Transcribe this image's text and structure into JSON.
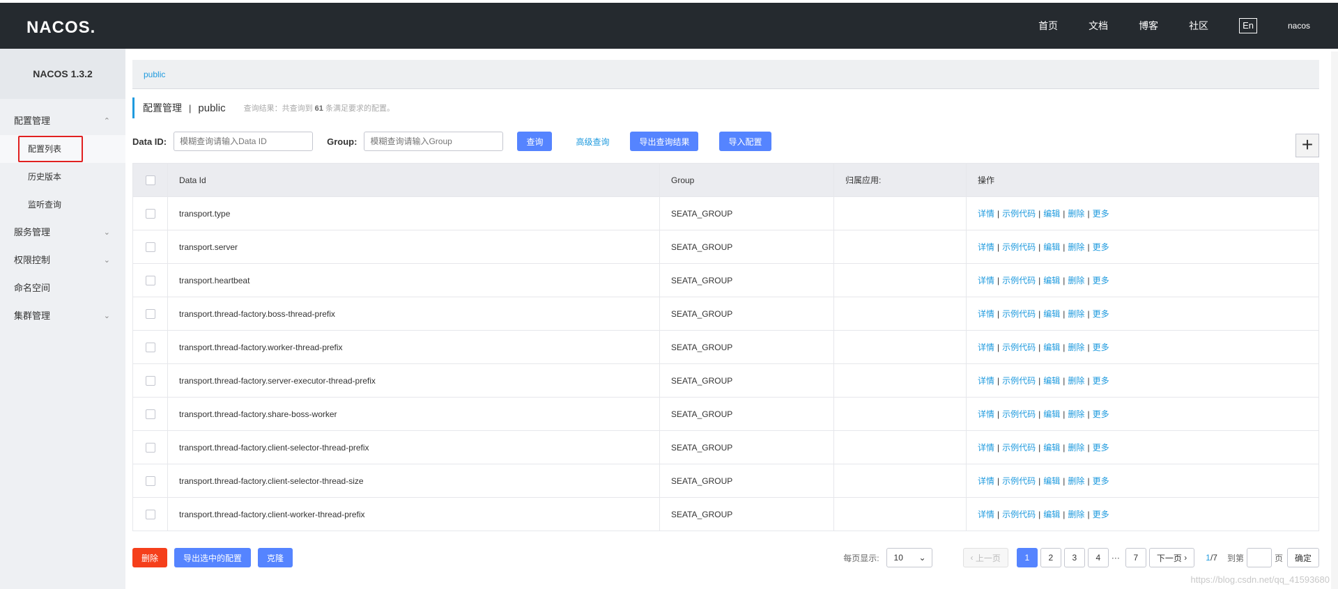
{
  "topbar": {
    "logo": "NACOS.",
    "nav": [
      "首页",
      "文档",
      "博客",
      "社区"
    ],
    "lang": "En",
    "user": "nacos"
  },
  "sidebar": {
    "version": "NACOS 1.3.2",
    "groups": [
      {
        "label": "配置管理",
        "items": [
          "配置列表",
          "历史版本",
          "监听查询"
        ]
      },
      {
        "label": "服务管理"
      },
      {
        "label": "权限控制"
      },
      {
        "label": "命名空间"
      },
      {
        "label": "集群管理"
      }
    ]
  },
  "breadcrumb": "public",
  "title": {
    "main": "配置管理",
    "sep": "|",
    "namespace": "public",
    "summary_prefix": "查询结果：共查询到",
    "summary_count": "61",
    "summary_suffix": "条满足要求的配置。"
  },
  "search": {
    "dataid_label": "Data ID:",
    "dataid_placeholder": "模糊查询请输入Data ID",
    "group_label": "Group:",
    "group_placeholder": "模糊查询请输入Group",
    "query_btn": "查询",
    "advanced": "高级查询",
    "export_btn": "导出查询结果",
    "import_btn": "导入配置",
    "plus": "+"
  },
  "table": {
    "headers": [
      "Data Id",
      "Group",
      "归属应用:",
      "操作"
    ],
    "ops": [
      "详情",
      "示例代码",
      "编辑",
      "删除",
      "更多"
    ],
    "rows": [
      {
        "dataId": "transport.type",
        "group": "SEATA_GROUP",
        "app": ""
      },
      {
        "dataId": "transport.server",
        "group": "SEATA_GROUP",
        "app": ""
      },
      {
        "dataId": "transport.heartbeat",
        "group": "SEATA_GROUP",
        "app": ""
      },
      {
        "dataId": "transport.thread-factory.boss-thread-prefix",
        "group": "SEATA_GROUP",
        "app": ""
      },
      {
        "dataId": "transport.thread-factory.worker-thread-prefix",
        "group": "SEATA_GROUP",
        "app": ""
      },
      {
        "dataId": "transport.thread-factory.server-executor-thread-prefix",
        "group": "SEATA_GROUP",
        "app": ""
      },
      {
        "dataId": "transport.thread-factory.share-boss-worker",
        "group": "SEATA_GROUP",
        "app": ""
      },
      {
        "dataId": "transport.thread-factory.client-selector-thread-prefix",
        "group": "SEATA_GROUP",
        "app": ""
      },
      {
        "dataId": "transport.thread-factory.client-selector-thread-size",
        "group": "SEATA_GROUP",
        "app": ""
      },
      {
        "dataId": "transport.thread-factory.client-worker-thread-prefix",
        "group": "SEATA_GROUP",
        "app": ""
      }
    ]
  },
  "footer": {
    "delete_btn": "删除",
    "export_selected_btn": "导出选中的配置",
    "clone_btn": "克隆",
    "page_size_label": "每页显示:",
    "page_size": "10",
    "prev": "上一页",
    "pages": [
      "1",
      "2",
      "3",
      "4"
    ],
    "ellipsis": "···",
    "last_page": "7",
    "next": "下一页",
    "current": "1",
    "total": "/7",
    "goto_label": "到第",
    "page_unit": "页",
    "ok_btn": "确定"
  },
  "watermark": "https://blog.csdn.net/qq_41593680"
}
